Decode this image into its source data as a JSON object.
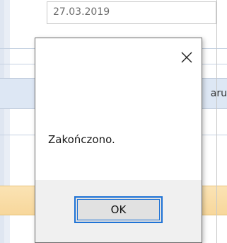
{
  "background": {
    "date_value": "27.03.2019",
    "header_fragment": "aru"
  },
  "dialog": {
    "message": "Zakończono.",
    "ok_label": "OK",
    "close_icon": "close-icon"
  },
  "colors": {
    "accent": "#1f73d6",
    "dialog_footer": "#f0f0f0",
    "orange_row": "#f7d79b"
  }
}
